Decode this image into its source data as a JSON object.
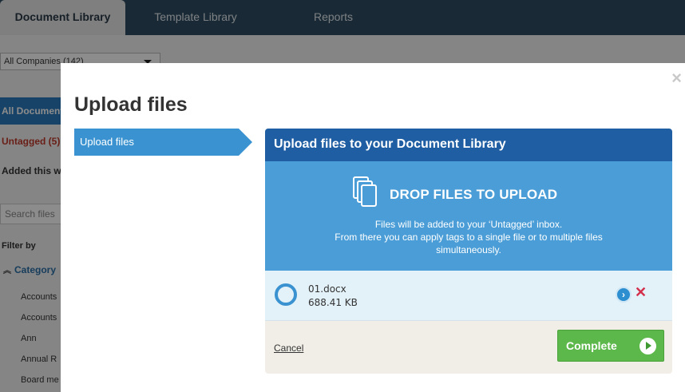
{
  "tabs": [
    {
      "label": "Document Library"
    },
    {
      "label": "Template Library"
    },
    {
      "label": "Reports"
    }
  ],
  "sidebar": {
    "company_select": "All Companies (142)",
    "all_documents": "All Documents",
    "untagged": "Untagged (5)",
    "added_this_week": "Added this week",
    "search_placeholder": "Search files",
    "filter_by": "Filter by",
    "category_heading": "Category",
    "categories": [
      "Accounts",
      "Accounts",
      "Ann",
      "Annual R",
      "Board me"
    ]
  },
  "modal": {
    "title": "Upload files",
    "close_glyph": "×",
    "step_label": "Upload files",
    "panel_title": "Upload files to your Document Library",
    "drop_title": "DROP FILES TO UPLOAD",
    "drop_lines": [
      "Files will be added to your ‘Untagged’ inbox.",
      "From there you can apply tags to a single file or to multiple files",
      "simultaneously."
    ],
    "file": {
      "name": "01.docx",
      "size": "688.41 KB"
    },
    "cancel_label": "Cancel",
    "complete_label": "Complete"
  },
  "colors": {
    "panel_header": "#1f5ea3",
    "drop_zone": "#4a9dd6",
    "complete_button": "#5cb84a",
    "remove": "#d32f4b"
  },
  "icons": {
    "drop": "documents-stack-icon",
    "file_status": "progress-ring-icon",
    "file_go": "chevron-right-circle-icon",
    "file_remove": "close-x-icon",
    "complete": "arrow-right-circle-icon"
  }
}
